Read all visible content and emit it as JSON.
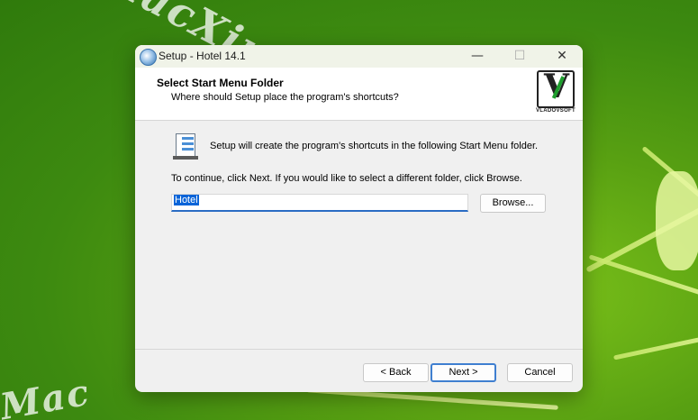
{
  "window": {
    "title": "Setup - Hotel 14.1",
    "minimize_glyph": "—",
    "maximize_glyph": "☐",
    "close_glyph": "✕"
  },
  "header": {
    "title": "Select Start Menu Folder",
    "subtitle": "Where should Setup place the program's shortcuts?",
    "logo_mark": "V",
    "logo_text": "VLADOVSOFT"
  },
  "body": {
    "info_text": "Setup will create the program's shortcuts in the following Start Menu folder.",
    "instruction": "To continue, click Next. If you would like to select a different folder, click Browse.",
    "folder_value": "Hotel",
    "browse_label": "Browse..."
  },
  "footer": {
    "back_label": "< Back",
    "next_label": "Next >",
    "cancel_label": "Cancel"
  },
  "watermark": {
    "site": "MacXin.com",
    "letters": "Mac"
  },
  "colors": {
    "accent": "#2a6cc4",
    "selection": "#0a64d8",
    "desktop_green": "#58a012"
  }
}
